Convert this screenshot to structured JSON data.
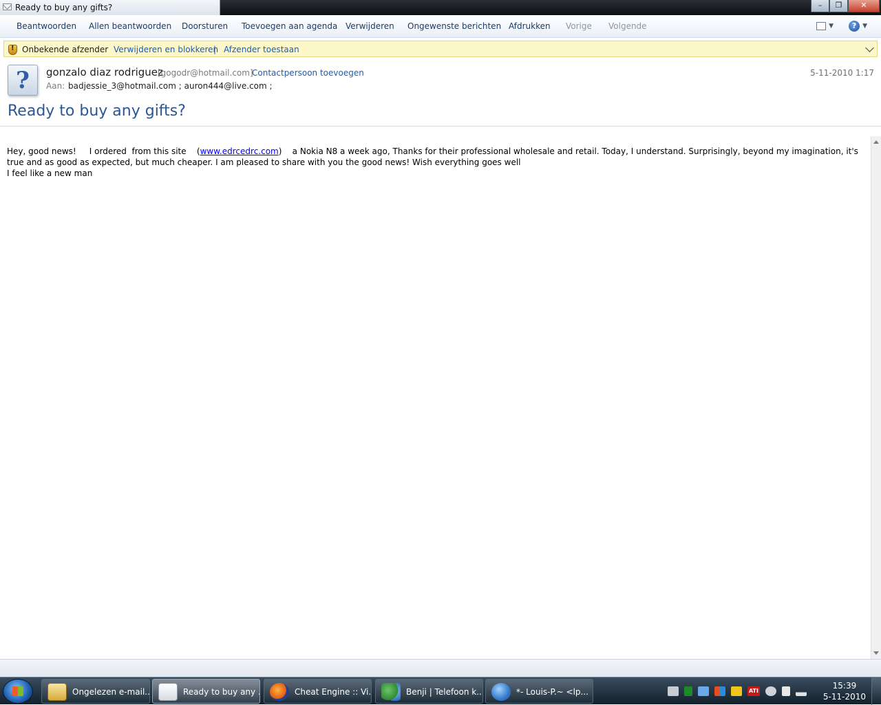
{
  "window": {
    "title": "Ready to buy any gifts?",
    "minimize": "–",
    "maximize": "❐",
    "close": "✕"
  },
  "toolbar": {
    "reply": "Beantwoorden",
    "reply_all": "Allen beantwoorden",
    "forward": "Doorsturen",
    "add_to_calendar": "Toevoegen aan agenda",
    "delete": "Verwijderen",
    "junk": "Ongewenste berichten",
    "print": "Afdrukken",
    "previous": "Vorige",
    "next": "Volgende",
    "help": "?"
  },
  "infobar": {
    "label": "Onbekende afzender",
    "delete_block": "Verwijderen en blokkeren",
    "separator": "|",
    "allow_sender": "Afzender toestaan"
  },
  "message": {
    "avatar_glyph": "?",
    "sender_name": "gonzalo diaz rodriguez",
    "sender_email": "[gogodr@hotmail.com]",
    "add_contact": "Contactpersoon toevoegen",
    "date": "5-11-2010 1:17",
    "to_label": "Aan:",
    "recipients": "badjessie_3@hotmail.com ;  auron444@live.com ;",
    "subject": "Ready to buy any gifts?",
    "body_part1": "Hey, good news!     I ordered  from this site    (",
    "body_link": "www.edrcedrc.com",
    "body_part2": ")    a Nokia N8 a week ago, Thanks for their professional wholesale and retail. Today, I understand. Surprisingly, beyond my imagination, it's true and as good as expected, but much cheaper. I am pleased to share with you the good news! Wish everything goes well",
    "body_line2": "I feel like a new man"
  },
  "taskbar": {
    "tasks": [
      {
        "label": "Ongelezen e-mail...",
        "icon": "mail-folder-icon"
      },
      {
        "label": "Ready to buy any ...",
        "icon": "envelope-icon"
      },
      {
        "label": "Cheat Engine :: Vi...",
        "icon": "firefox-icon"
      },
      {
        "label": "Benji | Telefoon k...",
        "icon": "contacts-icon"
      },
      {
        "label": "*- Louis-P.~ <lp...",
        "icon": "messenger-icon"
      }
    ],
    "tray_ati": "ATI",
    "clock_time": "15:39",
    "clock_date": "5-11-2010"
  },
  "colors": {
    "link": "#1c5bb5",
    "subject": "#2b5797",
    "infobar_bg": "#fdf8c9"
  }
}
